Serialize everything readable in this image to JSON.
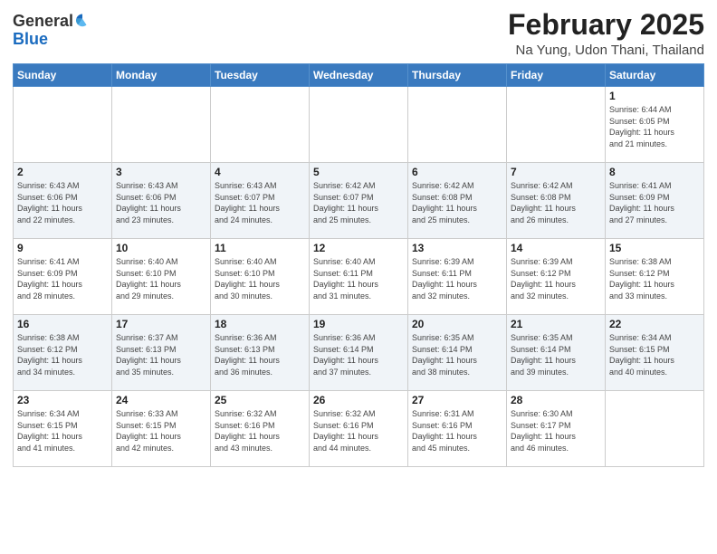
{
  "header": {
    "logo_general": "General",
    "logo_blue": "Blue",
    "title": "February 2025",
    "location": "Na Yung, Udon Thani, Thailand"
  },
  "days_of_week": [
    "Sunday",
    "Monday",
    "Tuesday",
    "Wednesday",
    "Thursday",
    "Friday",
    "Saturday"
  ],
  "weeks": [
    [
      {
        "day": "",
        "info": ""
      },
      {
        "day": "",
        "info": ""
      },
      {
        "day": "",
        "info": ""
      },
      {
        "day": "",
        "info": ""
      },
      {
        "day": "",
        "info": ""
      },
      {
        "day": "",
        "info": ""
      },
      {
        "day": "1",
        "info": "Sunrise: 6:44 AM\nSunset: 6:05 PM\nDaylight: 11 hours\nand 21 minutes."
      }
    ],
    [
      {
        "day": "2",
        "info": "Sunrise: 6:43 AM\nSunset: 6:06 PM\nDaylight: 11 hours\nand 22 minutes."
      },
      {
        "day": "3",
        "info": "Sunrise: 6:43 AM\nSunset: 6:06 PM\nDaylight: 11 hours\nand 23 minutes."
      },
      {
        "day": "4",
        "info": "Sunrise: 6:43 AM\nSunset: 6:07 PM\nDaylight: 11 hours\nand 24 minutes."
      },
      {
        "day": "5",
        "info": "Sunrise: 6:42 AM\nSunset: 6:07 PM\nDaylight: 11 hours\nand 25 minutes."
      },
      {
        "day": "6",
        "info": "Sunrise: 6:42 AM\nSunset: 6:08 PM\nDaylight: 11 hours\nand 25 minutes."
      },
      {
        "day": "7",
        "info": "Sunrise: 6:42 AM\nSunset: 6:08 PM\nDaylight: 11 hours\nand 26 minutes."
      },
      {
        "day": "8",
        "info": "Sunrise: 6:41 AM\nSunset: 6:09 PM\nDaylight: 11 hours\nand 27 minutes."
      }
    ],
    [
      {
        "day": "9",
        "info": "Sunrise: 6:41 AM\nSunset: 6:09 PM\nDaylight: 11 hours\nand 28 minutes."
      },
      {
        "day": "10",
        "info": "Sunrise: 6:40 AM\nSunset: 6:10 PM\nDaylight: 11 hours\nand 29 minutes."
      },
      {
        "day": "11",
        "info": "Sunrise: 6:40 AM\nSunset: 6:10 PM\nDaylight: 11 hours\nand 30 minutes."
      },
      {
        "day": "12",
        "info": "Sunrise: 6:40 AM\nSunset: 6:11 PM\nDaylight: 11 hours\nand 31 minutes."
      },
      {
        "day": "13",
        "info": "Sunrise: 6:39 AM\nSunset: 6:11 PM\nDaylight: 11 hours\nand 32 minutes."
      },
      {
        "day": "14",
        "info": "Sunrise: 6:39 AM\nSunset: 6:12 PM\nDaylight: 11 hours\nand 32 minutes."
      },
      {
        "day": "15",
        "info": "Sunrise: 6:38 AM\nSunset: 6:12 PM\nDaylight: 11 hours\nand 33 minutes."
      }
    ],
    [
      {
        "day": "16",
        "info": "Sunrise: 6:38 AM\nSunset: 6:12 PM\nDaylight: 11 hours\nand 34 minutes."
      },
      {
        "day": "17",
        "info": "Sunrise: 6:37 AM\nSunset: 6:13 PM\nDaylight: 11 hours\nand 35 minutes."
      },
      {
        "day": "18",
        "info": "Sunrise: 6:36 AM\nSunset: 6:13 PM\nDaylight: 11 hours\nand 36 minutes."
      },
      {
        "day": "19",
        "info": "Sunrise: 6:36 AM\nSunset: 6:14 PM\nDaylight: 11 hours\nand 37 minutes."
      },
      {
        "day": "20",
        "info": "Sunrise: 6:35 AM\nSunset: 6:14 PM\nDaylight: 11 hours\nand 38 minutes."
      },
      {
        "day": "21",
        "info": "Sunrise: 6:35 AM\nSunset: 6:14 PM\nDaylight: 11 hours\nand 39 minutes."
      },
      {
        "day": "22",
        "info": "Sunrise: 6:34 AM\nSunset: 6:15 PM\nDaylight: 11 hours\nand 40 minutes."
      }
    ],
    [
      {
        "day": "23",
        "info": "Sunrise: 6:34 AM\nSunset: 6:15 PM\nDaylight: 11 hours\nand 41 minutes."
      },
      {
        "day": "24",
        "info": "Sunrise: 6:33 AM\nSunset: 6:15 PM\nDaylight: 11 hours\nand 42 minutes."
      },
      {
        "day": "25",
        "info": "Sunrise: 6:32 AM\nSunset: 6:16 PM\nDaylight: 11 hours\nand 43 minutes."
      },
      {
        "day": "26",
        "info": "Sunrise: 6:32 AM\nSunset: 6:16 PM\nDaylight: 11 hours\nand 44 minutes."
      },
      {
        "day": "27",
        "info": "Sunrise: 6:31 AM\nSunset: 6:16 PM\nDaylight: 11 hours\nand 45 minutes."
      },
      {
        "day": "28",
        "info": "Sunrise: 6:30 AM\nSunset: 6:17 PM\nDaylight: 11 hours\nand 46 minutes."
      },
      {
        "day": "",
        "info": ""
      }
    ]
  ]
}
